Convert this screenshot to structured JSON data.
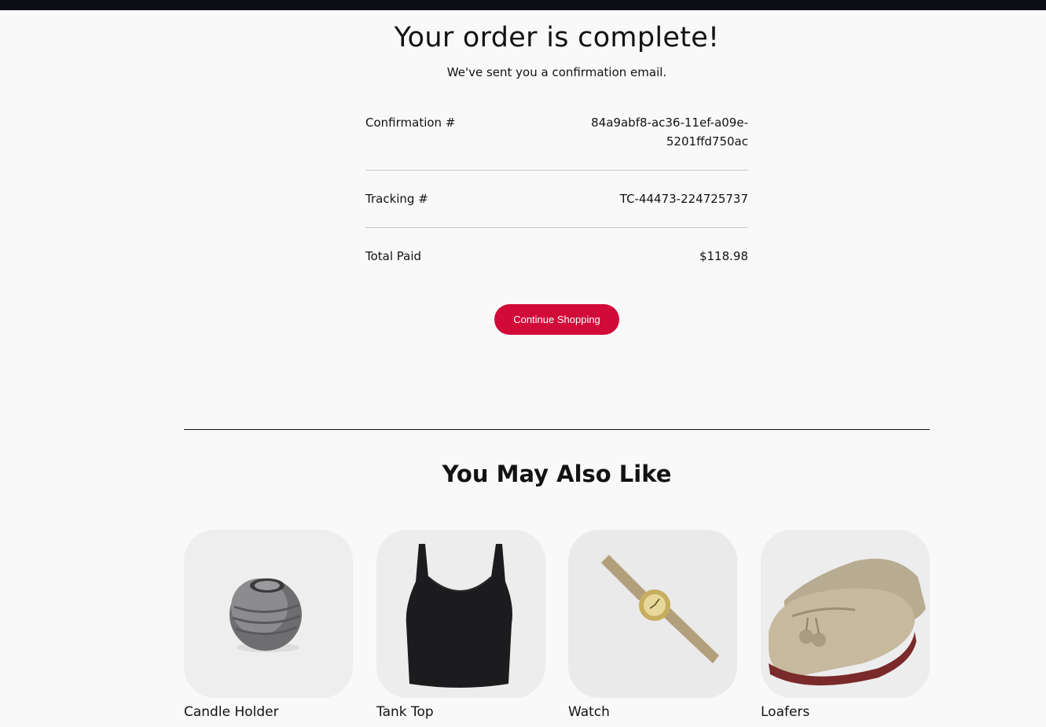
{
  "order": {
    "title": "Your order is complete!",
    "subtitle": "We've sent you a confirmation email.",
    "confirmation_label": "Confirmation #",
    "confirmation_value_line1": "84a9abf8-ac36-11ef-a09e-",
    "confirmation_value_line2": "5201ffd750ac",
    "tracking_label": "Tracking #",
    "tracking_value": "TC-44473-224725737",
    "total_label": "Total Paid",
    "total_value": "$118.98",
    "button_label": "Continue Shopping"
  },
  "recommendations": {
    "title": "You May Also Like",
    "items": [
      {
        "name": "Candle Holder"
      },
      {
        "name": "Tank Top"
      },
      {
        "name": "Watch"
      },
      {
        "name": "Loafers"
      }
    ]
  },
  "colors": {
    "accent": "#d10a38",
    "background": "#f9f9f9",
    "topbar": "#0c0f14"
  }
}
